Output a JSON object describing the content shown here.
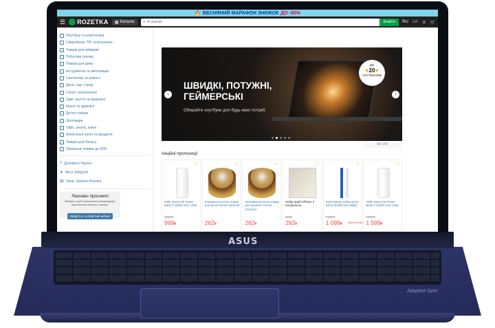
{
  "promo": {
    "text": "ВЕСНЯНИЙ МАРАФОН ЗНИЖОК",
    "discount": "ДО -60%"
  },
  "header": {
    "brand": "ROZETKA",
    "catalog_label": "Каталог",
    "search_placeholder": "Я шукаю",
    "search_button": "Знайти",
    "lang_ru": "RU",
    "lang_ua": "UA"
  },
  "sidebar": {
    "categories": [
      "Ноутбуки та комп'ютери",
      "Смартфони, ТВ і електроніка",
      "Товари для геймерів",
      "Побутова техніка",
      "Товари для дому",
      "Інструменти та автотовари",
      "Сантехніка та ремонт",
      "Дача, сад і город",
      "Спорт і захоплення",
      "Одяг, взуття та прикраси",
      "Краса та здоров'я",
      "Дитячі товари",
      "Зоотовари",
      "Офіс, школа, книги",
      "Алкогольні напої та продукти",
      "Товари для бізнесу",
      "Українські знижки до 60%"
    ],
    "misc": [
      "Допомога Україні",
      "Ми в Telegram",
      "Тема: Україна Rozetka"
    ],
    "welcome": {
      "title": "Ласкаво просимо!",
      "subtitle": "Увійдіть, щоб отримувати рекомендації, персональні бонуси і знижки.",
      "button": "Увійдіть в особистий кабінет"
    }
  },
  "banner": {
    "headline": "ШВИДКІ, ПОТУЖНІ, ГЕЙМЕРСЬКІ",
    "subline": "Обирайте ноутбуки для будь-яких потреб",
    "badge_top": "ДО",
    "badge_num": "20",
    "badge_bottom": "ЧАСТИНАМИ",
    "show_all": "Усі",
    "show_all_count": "140"
  },
  "section_title": "Акційні пропозиції",
  "products": [
    {
      "name": "УМБ Xiaomi Mi Power Bank 3 10000 mAh USB-",
      "old": "1 499 ₴",
      "price": "999",
      "currency": "₴",
      "img": "powerbank"
    },
    {
      "name": "Упаковка вологого корму для кішок Purina Gourmet",
      "old": "",
      "price": "262",
      "currency": "₴",
      "img": "can"
    },
    {
      "name": "Упаковка вологого корму для кошенят Purina Gourmet",
      "old": "",
      "price": "262",
      "currency": "₴",
      "img": "can"
    },
    {
      "name": "Набір Spell Gift Box II натуральна",
      "old": "345 ₴",
      "price": "292",
      "currency": "₴",
      "img": "gift"
    },
    {
      "name": "Електрична зубна щітка ORAL-B BRAUN Vitality",
      "old": "1 099 ₴",
      "price": "1 099",
      "currency": "₴",
      "extra": "Закінчується",
      "img": "brush"
    },
    {
      "name": "УМБ Xiaomi Mi Power Bank 3 20000 mAh USB-",
      "old": "1 999 ₴",
      "price": "1 599",
      "currency": "₴",
      "img": "powerbank"
    }
  ],
  "laptop": {
    "brand": "ASUS",
    "sticker": "Adaptive Sync"
  }
}
